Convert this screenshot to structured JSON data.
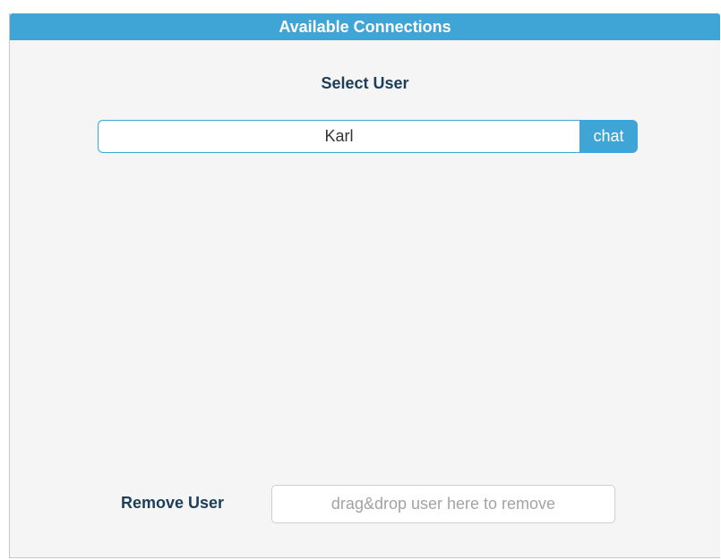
{
  "panel": {
    "title": "Available Connections"
  },
  "select_user": {
    "label": "Select User",
    "selected_user": "Karl",
    "chat_label": "chat"
  },
  "remove_user": {
    "label": "Remove User",
    "drop_placeholder": "drag&drop user here to remove"
  },
  "colors": {
    "accent": "#3fa4d6",
    "label_text": "#1d3e58",
    "panel_background": "#f5f5f5"
  }
}
